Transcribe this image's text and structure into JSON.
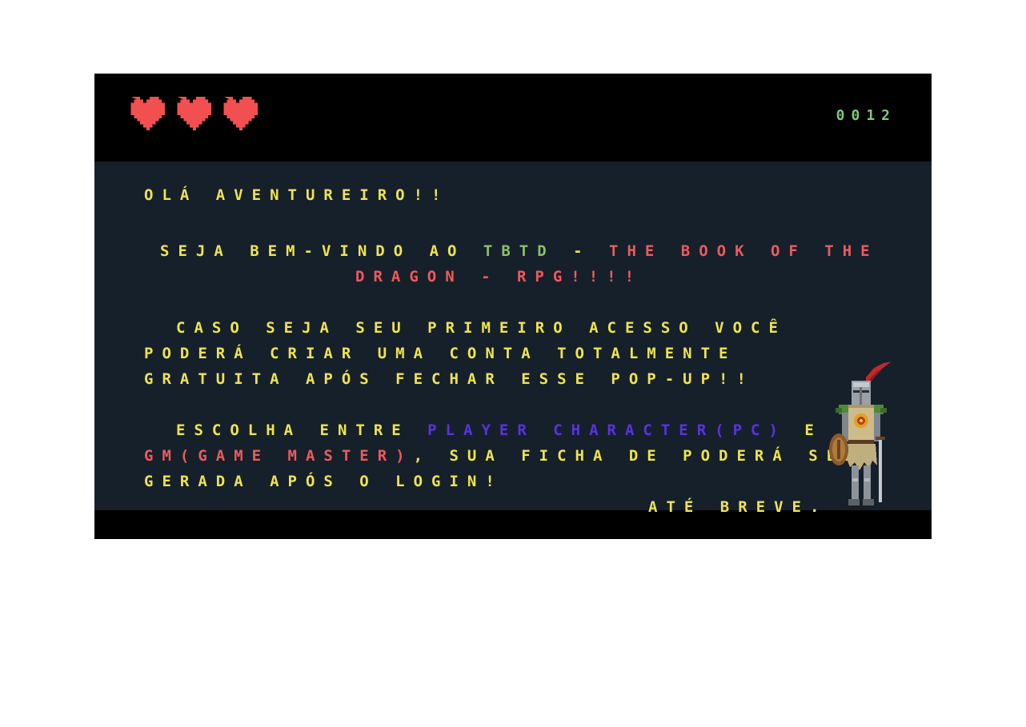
{
  "hud": {
    "lives": 3,
    "score": "0012",
    "heart_color": "#f25050"
  },
  "message": {
    "greeting": "OLÁ AVENTUREIRO!!",
    "welcome_prefix": "SEJA BEM-VINDO AO ",
    "welcome_tbtd": "TBTD",
    "welcome_dash": " - ",
    "welcome_title_1": "THE BOOK OF THE",
    "welcome_title_2": "DRAGON - RPG!!!!",
    "first_access_1": "CASO SEJA SEU PRIMEIRO ACESSO VOCÊ",
    "first_access_2": "PODERÁ CRIAR UMA CONTA TOTALMENTE",
    "first_access_3": "GRATUITA APÓS FECHAR ESSE POP-UP!!",
    "choose_prefix": "ESCOLHA ENTRE ",
    "choose_pc": "PLAYER CHARACTER(PC)",
    "choose_e": " E",
    "choose_gm": "GM(GAME MASTER)",
    "choose_suffix": ", SUA FICHA DE PODERÁ SER",
    "choose_3": "GERADA APÓS O LOGIN!",
    "farewell": "ATÉ BREVE."
  },
  "colors": {
    "panel_bg": "#16202b",
    "bar_bg": "#000000",
    "text_yellow": "#f0e44a",
    "text_green": "#8cc063",
    "text_red": "#ee5a5a",
    "text_purple": "#5a32e0",
    "score_green": "#7fc97a"
  },
  "icons": {
    "life": "pixel-heart-icon",
    "character": "knight-sprite"
  }
}
